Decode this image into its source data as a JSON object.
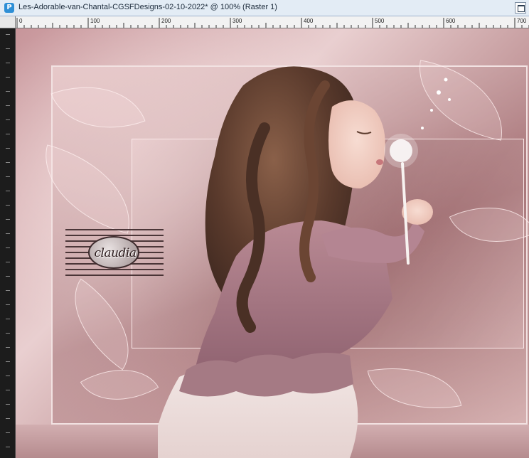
{
  "window": {
    "title": "Les-Adorable-van-Chantal-CGSFDesigns-02-10-2022* @ 100% (Raster 1)",
    "app_icon": "psp-app-icon"
  },
  "ruler": {
    "labels": [
      "0",
      "100",
      "200",
      "300",
      "400",
      "500",
      "600",
      "700"
    ]
  },
  "canvas": {
    "watermark_text": "claudia"
  },
  "colors": {
    "titlebar_bg": "#e3ecf5",
    "ruler_bg": "#f2f2f2",
    "canvas_pink": "#c7959a",
    "dress_mauve": "#a97b86"
  }
}
